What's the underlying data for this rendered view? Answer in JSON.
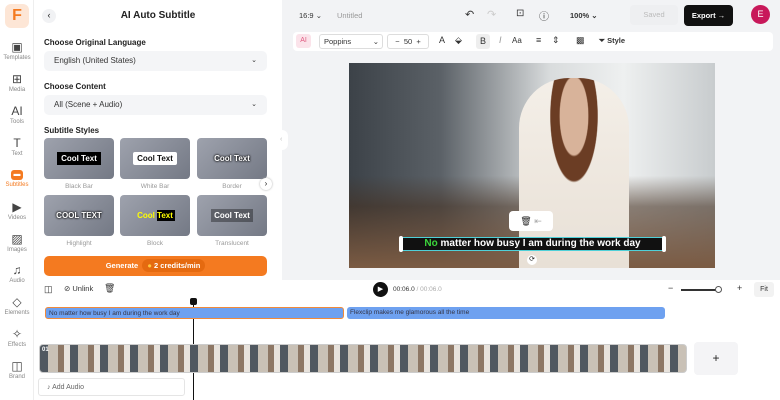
{
  "nav": {
    "items": [
      {
        "label": "Templates",
        "icon": "templates-icon"
      },
      {
        "label": "Media",
        "icon": "media-icon"
      },
      {
        "label": "Tools",
        "icon": "ai-tools-icon"
      },
      {
        "label": "Text",
        "icon": "text-icon"
      },
      {
        "label": "Subtitles",
        "icon": "subtitles-icon",
        "active": true
      },
      {
        "label": "Videos",
        "icon": "videos-icon"
      },
      {
        "label": "Images",
        "icon": "images-icon"
      },
      {
        "label": "Audio",
        "icon": "audio-icon"
      },
      {
        "label": "Elements",
        "icon": "elements-icon"
      },
      {
        "label": "Effects",
        "icon": "effects-icon"
      },
      {
        "label": "Brand",
        "icon": "brand-icon"
      }
    ]
  },
  "panel": {
    "title": "AI Auto Subtitle",
    "language_label": "Choose Original Language",
    "language_value": "English (United States)",
    "content_label": "Choose Content",
    "content_value": "All (Scene + Audio)",
    "styles_label": "Subtitle Styles",
    "styles": [
      {
        "name": "Black Bar",
        "sample": "Cool Text"
      },
      {
        "name": "White Bar",
        "sample": "Cool Text"
      },
      {
        "name": "Border",
        "sample": "Cool Text"
      },
      {
        "name": "Highlight",
        "sample": "COOL TEXT"
      },
      {
        "name": "Block",
        "sample": "Cool Text"
      },
      {
        "name": "Translucent",
        "sample": "Cool Text"
      }
    ],
    "generate_label": "Generate",
    "credits": "2 credits/min"
  },
  "topbar": {
    "ratio": "16:9",
    "project_name": "Untitled",
    "zoom": "100%",
    "saved": "Saved",
    "export": "Export",
    "avatar": "E"
  },
  "format": {
    "font": "Poppins",
    "size": "50",
    "style": "Style"
  },
  "canvas": {
    "subtitle_first": "No",
    "subtitle_rest": " matter how busy I am during the work day",
    "highlight_color": "#3cd63c"
  },
  "timeline": {
    "unlink": "Unlink",
    "time_current": "00:06.0",
    "time_total": "00:06.0",
    "fit": "Fit",
    "clips": [
      "No matter how busy I am during the work day",
      "Flexclip makes me glamorous all the time"
    ],
    "track_index": "01",
    "add_audio": "Add Audio"
  },
  "colors": {
    "accent": "#f47a20",
    "export_bg": "#111111",
    "avatar": "#c8185a"
  }
}
